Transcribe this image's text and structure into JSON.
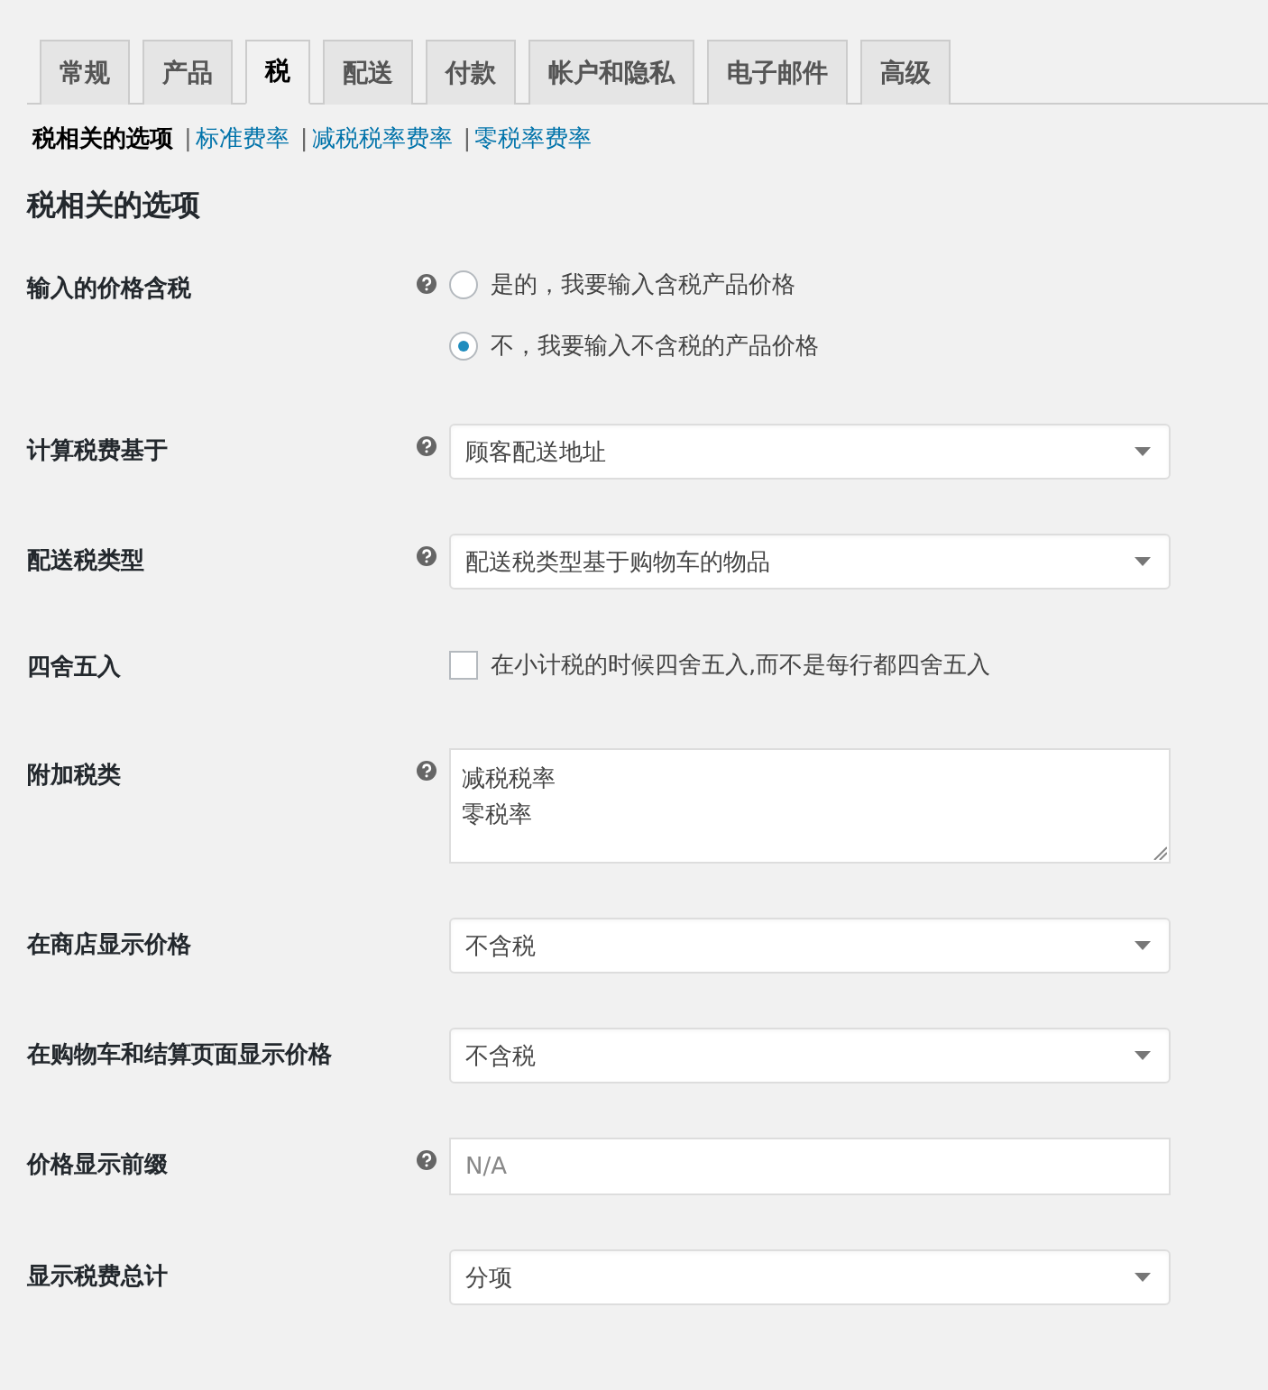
{
  "tabs": [
    {
      "label": "常规",
      "selected": false
    },
    {
      "label": "产品",
      "selected": false
    },
    {
      "label": "税",
      "selected": true
    },
    {
      "label": "配送",
      "selected": false
    },
    {
      "label": "付款",
      "selected": false
    },
    {
      "label": "帐户和隐私",
      "selected": false
    },
    {
      "label": "电子邮件",
      "selected": false
    },
    {
      "label": "高级",
      "selected": false
    }
  ],
  "subnav": [
    {
      "label": "税相关的选项",
      "selected": true
    },
    {
      "separator": "|",
      "label": "标准费率",
      "selected": false
    },
    {
      "separator": "|",
      "label": "减税税率费率",
      "selected": false
    },
    {
      "separator": "|",
      "label": "零税率费率",
      "selected": false
    }
  ],
  "section_title": "税相关的选项",
  "settings": [
    {
      "kind": "radio",
      "label": "输入的价格含税",
      "help": true,
      "options": [
        {
          "label": "是的，我要输入含税产品价格",
          "selected": false
        },
        {
          "label": "不，我要输入不含税的产品价格",
          "selected": true
        }
      ]
    },
    {
      "kind": "select",
      "label": "计算税费基于",
      "help": true,
      "value": "顾客配送地址"
    },
    {
      "kind": "select",
      "label": "配送税类型",
      "help": true,
      "value": "配送税类型基于购物车的物品"
    },
    {
      "kind": "checkbox",
      "label": "四舍五入",
      "help": false,
      "checked": false,
      "option": "在小计税的时候四舍五入,而不是每行都四舍五入"
    },
    {
      "kind": "textarea",
      "label": "附加税类",
      "help": true,
      "lines": [
        "减税税率",
        "零税率"
      ]
    },
    {
      "kind": "select",
      "label": "在商店显示价格",
      "help": false,
      "value": "不含税"
    },
    {
      "kind": "select",
      "label": "在购物车和结算页面显示价格",
      "help": false,
      "value": "不含税"
    },
    {
      "kind": "text",
      "label": "价格显示前缀",
      "help": true,
      "placeholder": "N/A"
    },
    {
      "kind": "select",
      "label": "显示税费总计",
      "help": false,
      "value": "分项"
    }
  ]
}
